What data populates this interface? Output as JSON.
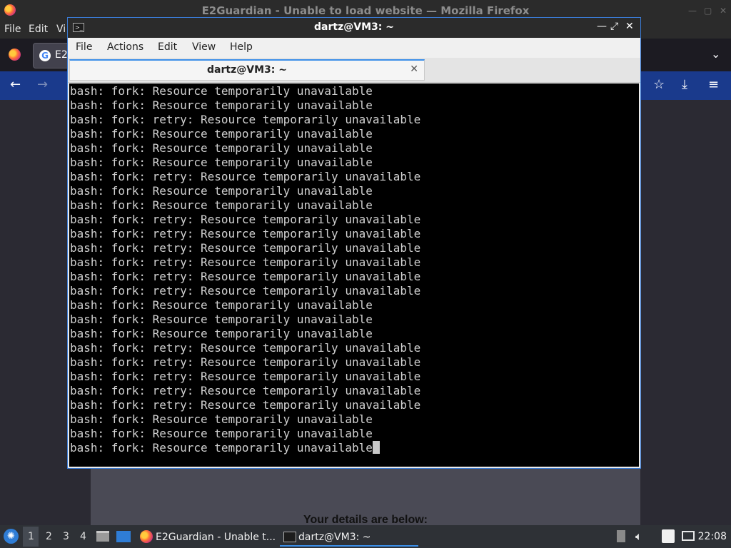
{
  "firefox": {
    "title": "E2Guardian - Unable to load website — Mozilla Firefox",
    "menu": [
      "File",
      "Edit",
      "Vi"
    ],
    "tab_label": "E2",
    "page_text": "Your details are below:"
  },
  "terminal": {
    "title": "dartz@VM3: ~",
    "menu": [
      "File",
      "Actions",
      "Edit",
      "View",
      "Help"
    ],
    "tab_label": "dartz@VM3: ~",
    "lines": [
      "bash: fork: Resource temporarily unavailable",
      "bash: fork: Resource temporarily unavailable",
      "bash: fork: retry: Resource temporarily unavailable",
      "bash: fork: Resource temporarily unavailable",
      "bash: fork: Resource temporarily unavailable",
      "bash: fork: Resource temporarily unavailable",
      "bash: fork: retry: Resource temporarily unavailable",
      "bash: fork: Resource temporarily unavailable",
      "bash: fork: Resource temporarily unavailable",
      "bash: fork: retry: Resource temporarily unavailable",
      "bash: fork: retry: Resource temporarily unavailable",
      "bash: fork: retry: Resource temporarily unavailable",
      "bash: fork: retry: Resource temporarily unavailable",
      "bash: fork: retry: Resource temporarily unavailable",
      "bash: fork: retry: Resource temporarily unavailable",
      "bash: fork: Resource temporarily unavailable",
      "bash: fork: Resource temporarily unavailable",
      "bash: fork: Resource temporarily unavailable",
      "bash: fork: retry: Resource temporarily unavailable",
      "bash: fork: retry: Resource temporarily unavailable",
      "bash: fork: retry: Resource temporarily unavailable",
      "bash: fork: retry: Resource temporarily unavailable",
      "bash: fork: retry: Resource temporarily unavailable",
      "bash: fork: Resource temporarily unavailable",
      "bash: fork: Resource temporarily unavailable",
      "bash: fork: Resource temporarily unavailable"
    ]
  },
  "taskbar": {
    "workspaces": [
      "1",
      "2",
      "3",
      "4"
    ],
    "firefox_task": "E2Guardian - Unable t...",
    "terminal_task": "dartz@VM3: ~",
    "clock": "22:08"
  },
  "icons": {
    "firefox": "firefox-icon",
    "google": "google-icon",
    "back": "back-arrow-icon",
    "forward": "forward-arrow-icon",
    "bookmark": "star-icon",
    "download": "download-icon",
    "menu": "hamburger-menu-icon",
    "terminal": "terminal-icon"
  }
}
